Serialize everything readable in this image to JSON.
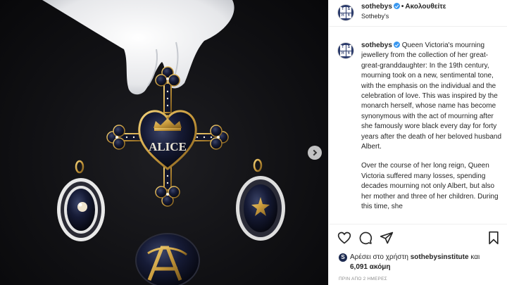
{
  "header": {
    "username": "sothebys",
    "follow_label": "Ακολουθείτε",
    "location": "Sotheby's"
  },
  "caption": {
    "username": "sothebys",
    "paragraph1": "Queen Victoria's mourning jewellery from the collection of her great-great-granddaughter: In the 19th century, mourning took on a new, sentimental tone, with the emphasis on the individual and the celebration of love. This was inspired by the monarch herself, whose name has become synonymous with the act of mourning after she famously wore black every day for forty years after the death of her beloved husband Albert.",
    "paragraph2": "Over the course of her long reign, Queen Victoria suffered many losses, spending decades mourning not only Albert, but also her mother and three of her children. During this time, she"
  },
  "photo": {
    "pendant_text": "ALICE"
  },
  "likes": {
    "prefix": "Αρέσει στο χρήστη",
    "liker": "sothebysinstitute",
    "joiner": "και",
    "count": "6,091 ακόμη"
  },
  "timestamp": "ΠΡΙΝ ΑΠΟ 2 ΗΜΕΡΕΣ",
  "colors": {
    "verified": "#3897f0",
    "avatar_bg": "#2a3a6b",
    "jewel_gold": "#c8a24a",
    "enamel": "#141a33"
  },
  "icons": [
    "heart-icon",
    "comment-icon",
    "share-icon",
    "bookmark-icon",
    "next-arrow-icon",
    "verified-icon"
  ]
}
